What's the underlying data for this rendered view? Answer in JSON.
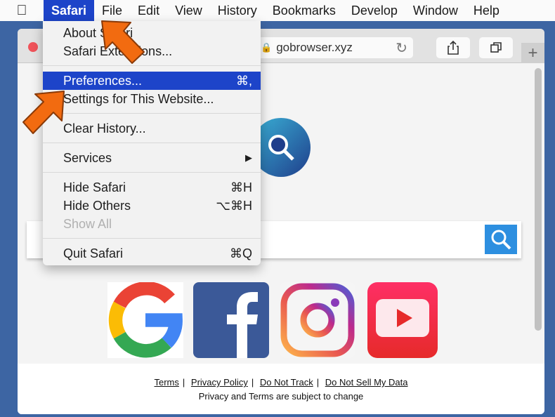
{
  "menubar": {
    "items": [
      "Safari",
      "File",
      "Edit",
      "View",
      "History",
      "Bookmarks",
      "Develop",
      "Window",
      "Help"
    ]
  },
  "browser": {
    "url": "gobrowser.xyz",
    "search_placeholder": ""
  },
  "safari_menu": {
    "about": "About Safari",
    "extensions": "Safari Extensions...",
    "preferences": "Preferences...",
    "preferences_shortcut": "⌘,",
    "site_settings": "Settings for This Website...",
    "clear_history": "Clear History...",
    "services": "Services",
    "services_arrow": "▶",
    "hide_safari": "Hide Safari",
    "hide_safari_shortcut": "⌘H",
    "hide_others": "Hide Others",
    "hide_others_shortcut": "⌥⌘H",
    "show_all": "Show All",
    "quit": "Quit Safari",
    "quit_shortcut": "⌘Q"
  },
  "footer": {
    "links": [
      "Terms",
      "Privacy Policy",
      "Do Not Track",
      "Do Not Sell My Data"
    ],
    "separator": "|",
    "note": "Privacy and Terms are subject to change"
  },
  "colors": {
    "highlight": "#1d44c9",
    "arrow": "#f26b10",
    "search_button": "#2d8fe0"
  }
}
